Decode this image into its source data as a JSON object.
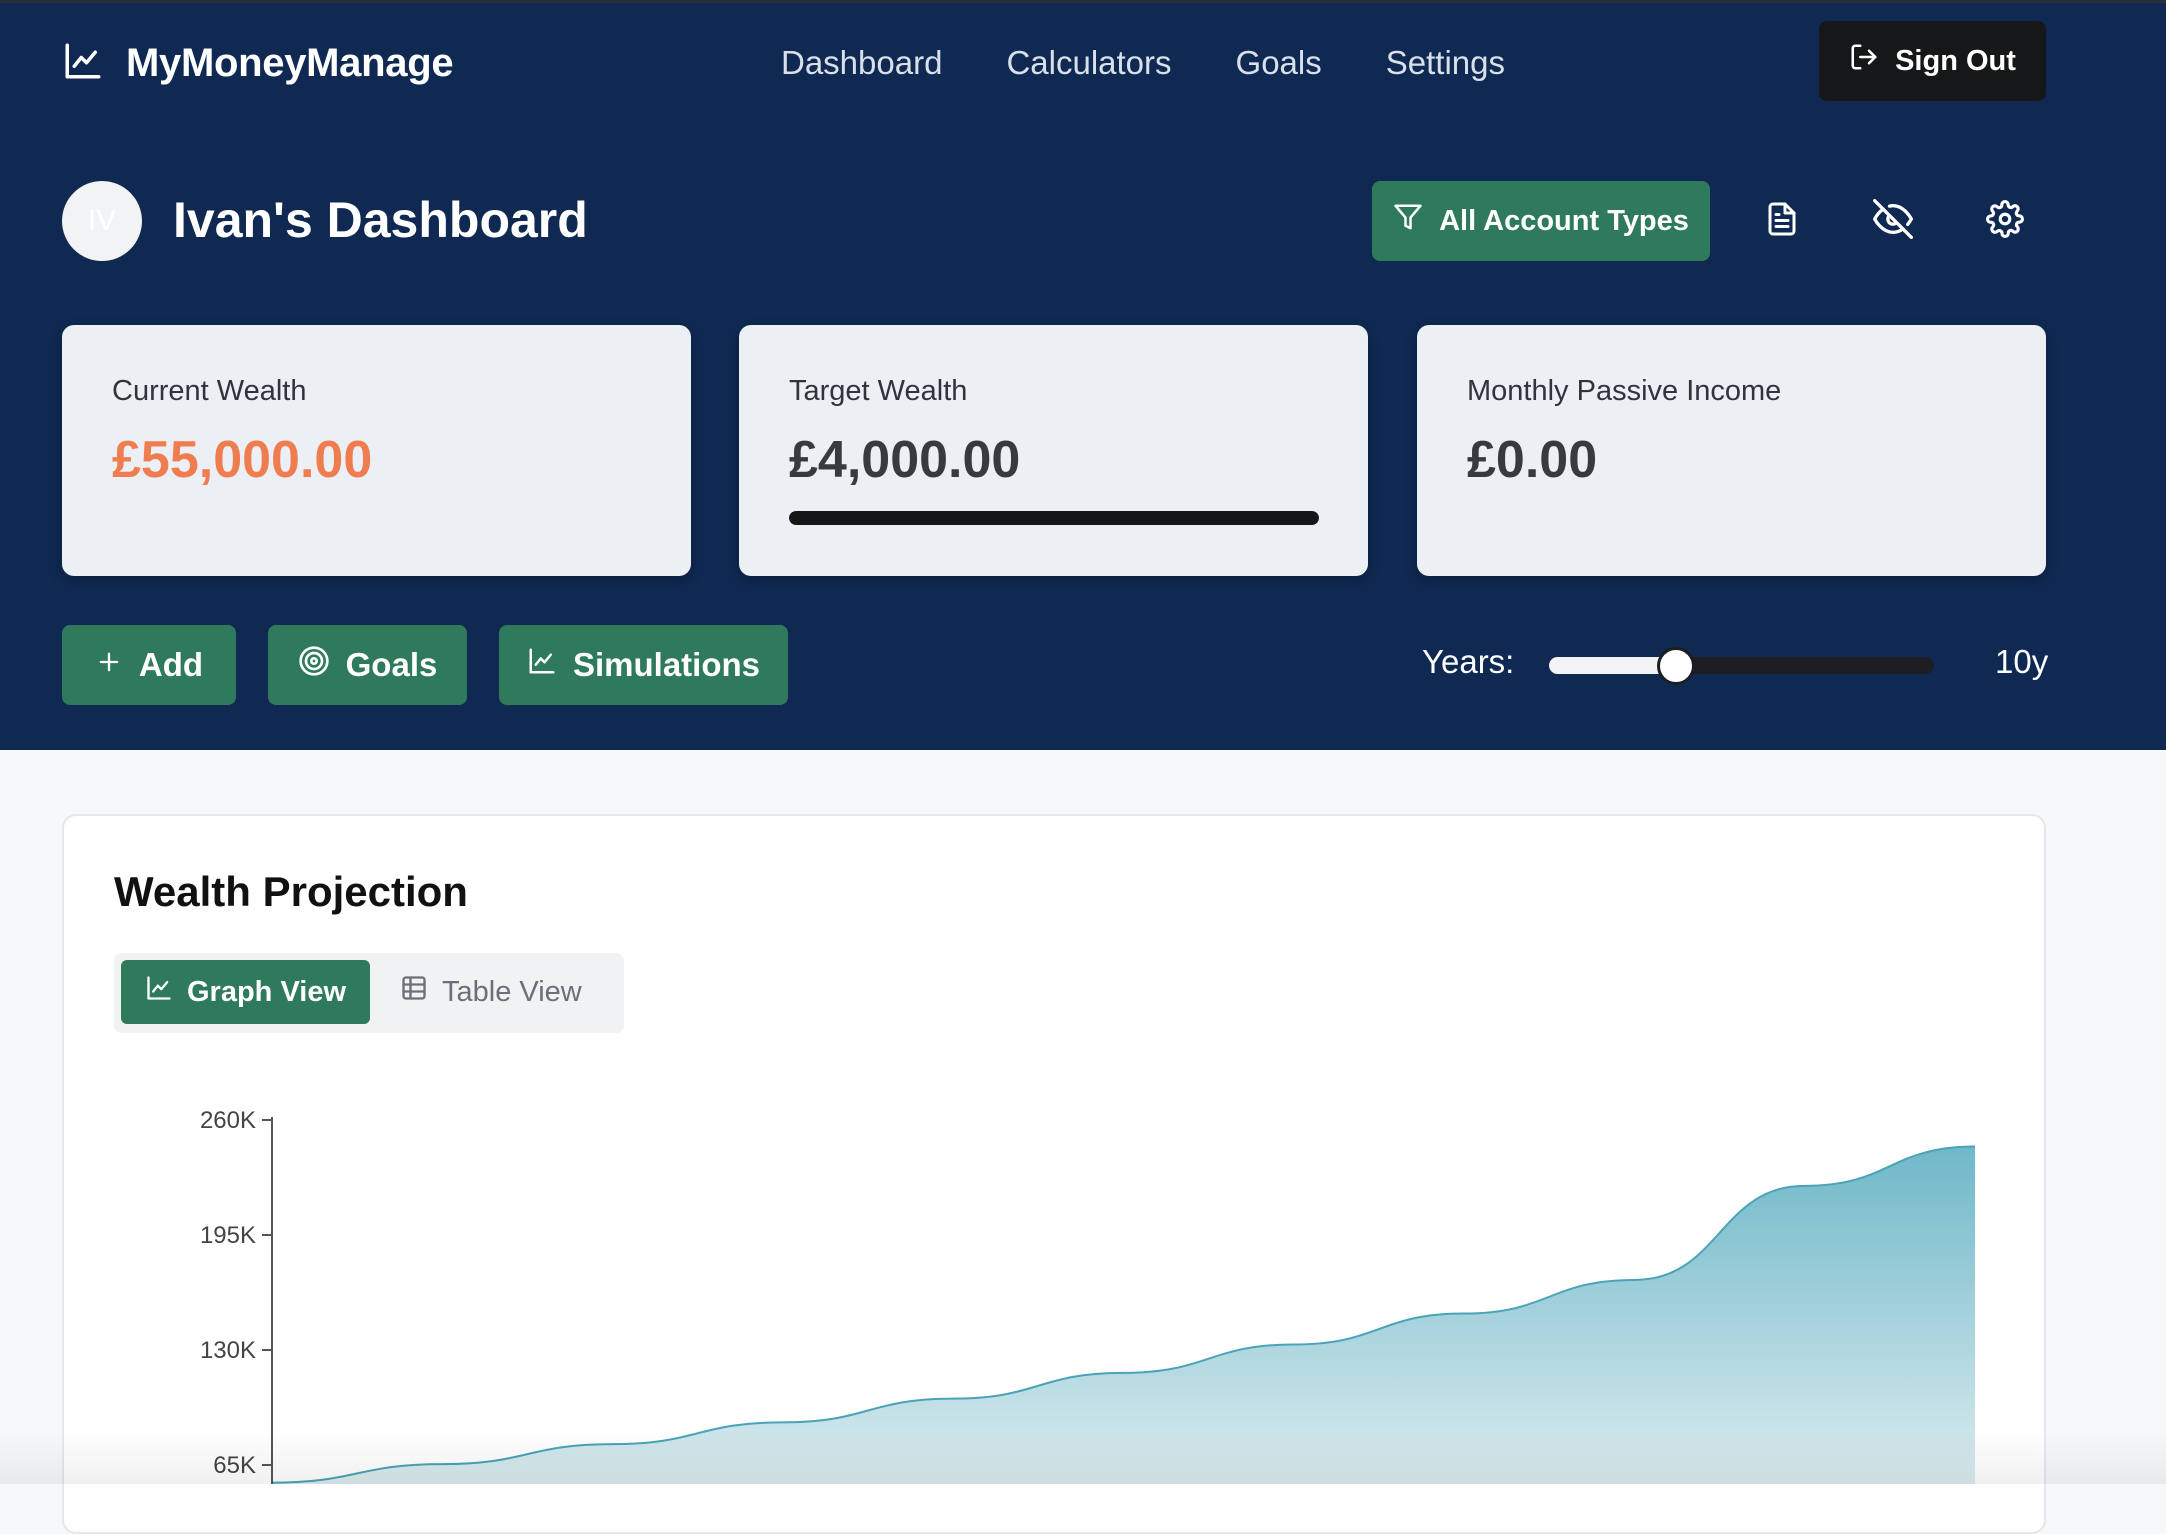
{
  "app": {
    "name": "MyMoneyManage"
  },
  "nav": {
    "links": [
      "Dashboard",
      "Calculators",
      "Goals",
      "Settings"
    ],
    "sign_out_label": "Sign Out"
  },
  "header": {
    "avatar_initials": "IV",
    "title": "Ivan's Dashboard",
    "filter_label": "All Account Types"
  },
  "stats": {
    "current_wealth": {
      "label": "Current Wealth",
      "value": "£55,000.00"
    },
    "target_wealth": {
      "label": "Target Wealth",
      "value": "£4,000.00",
      "progress": 1.0
    },
    "passive_income": {
      "label": "Monthly Passive Income",
      "value": "£0.00"
    }
  },
  "actions": {
    "add_label": "Add",
    "goals_label": "Goals",
    "simulations_label": "Simulations"
  },
  "years": {
    "label": "Years:",
    "value_text": "10y",
    "slider_fraction": 0.33
  },
  "projection": {
    "title": "Wealth Projection",
    "graph_view_label": "Graph View",
    "table_view_label": "Table View"
  },
  "colors": {
    "hero_bg": "#0f2952",
    "green": "#2f7a5b",
    "orange": "#ef7d4f",
    "area_top": "#6fb8c9",
    "area_bottom": "#d6eaee"
  },
  "chart_data": {
    "type": "area",
    "y_ticks": [
      {
        "value": 260000,
        "label": "260K"
      },
      {
        "value": 195000,
        "label": "195K"
      },
      {
        "value": 130000,
        "label": "130K"
      },
      {
        "value": 65000,
        "label": "65K"
      }
    ],
    "ylim": [
      55000,
      260000
    ],
    "x": [
      0,
      1,
      2,
      3,
      4,
      5,
      6,
      7,
      8,
      9,
      10
    ],
    "values": [
      55000,
      65500,
      76800,
      89100,
      102500,
      117100,
      133100,
      150600,
      169600,
      222800,
      245000
    ]
  }
}
